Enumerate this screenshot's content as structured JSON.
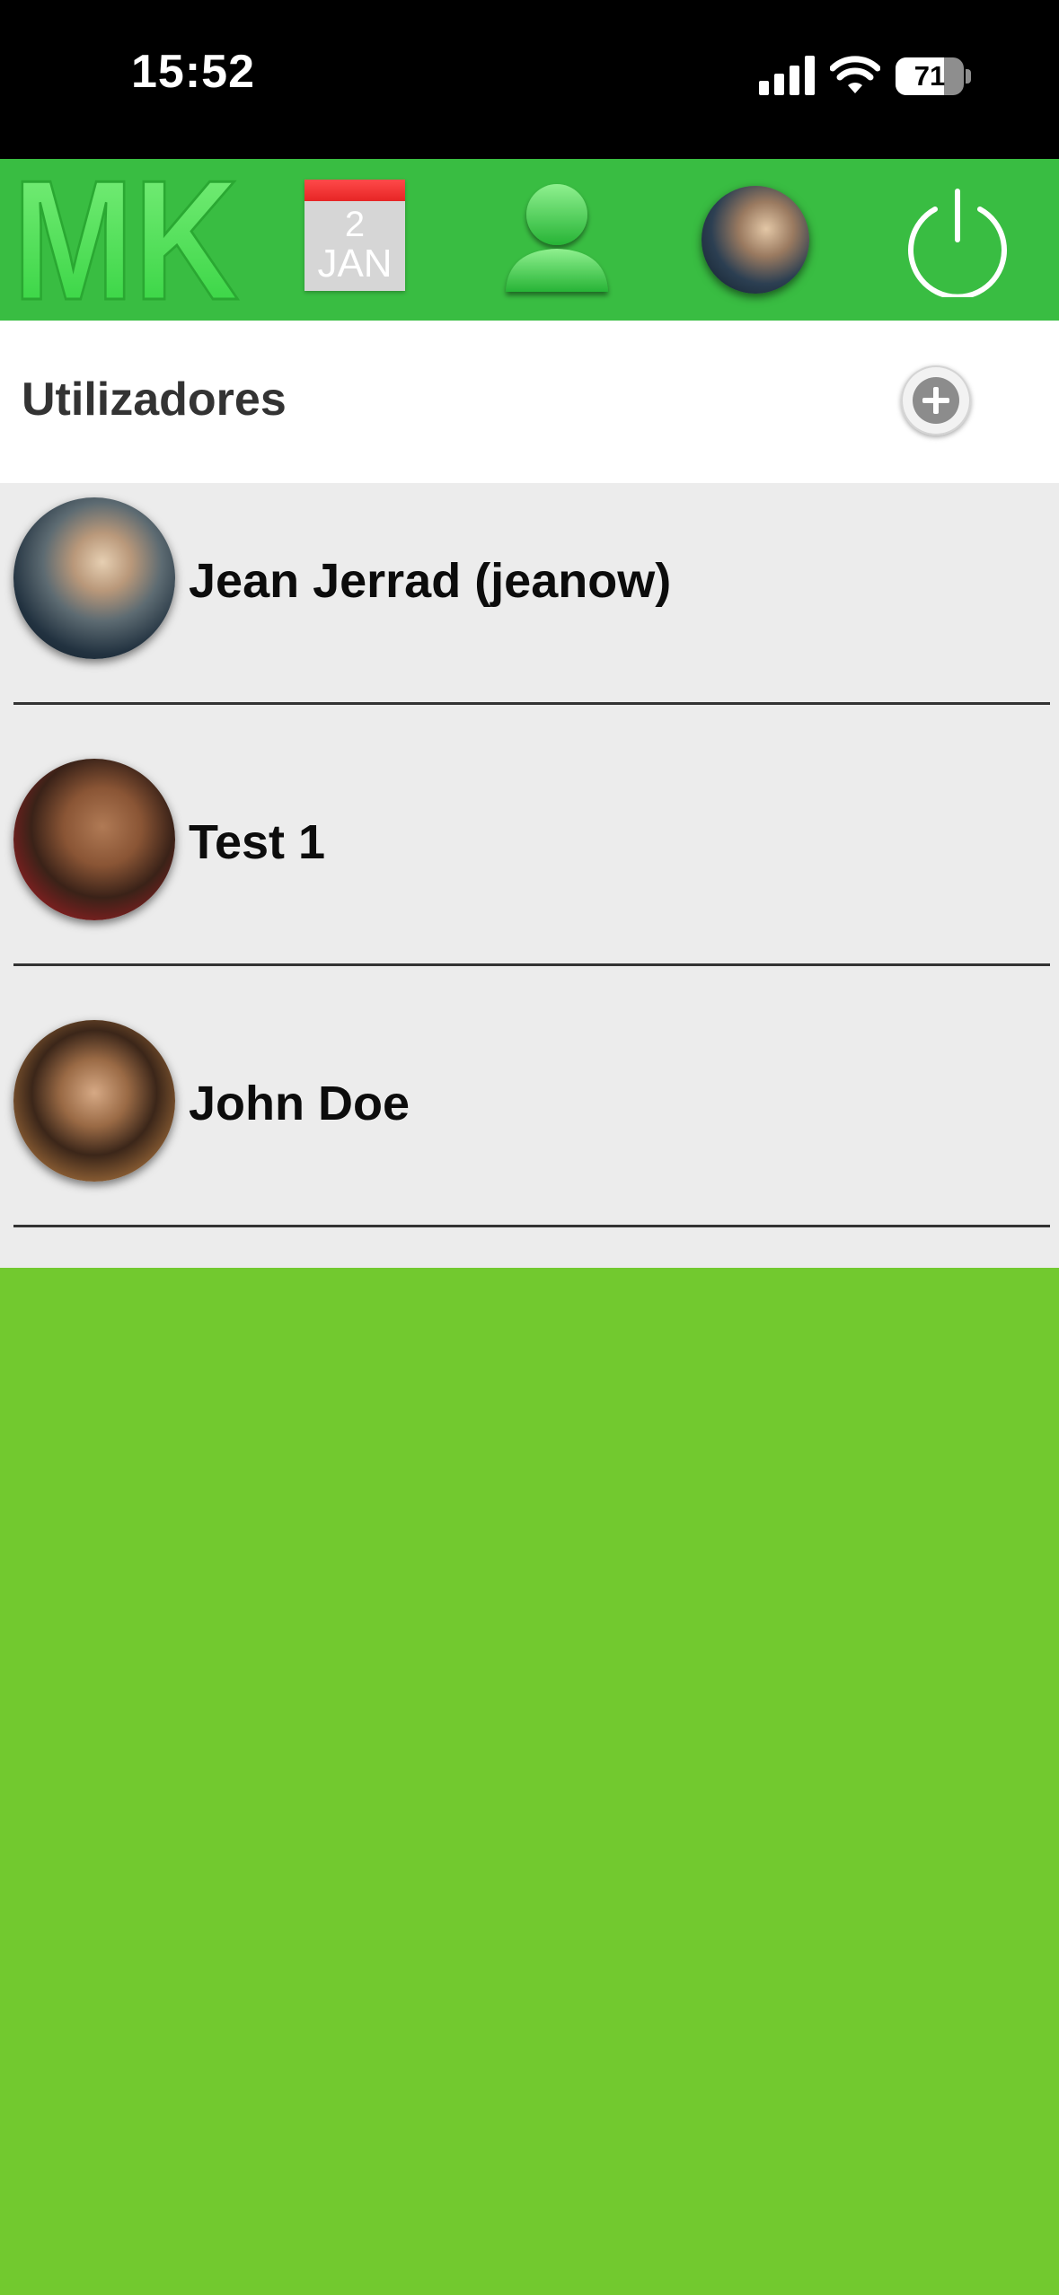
{
  "status_bar": {
    "time": "15:52",
    "battery_level": "71",
    "battery_fraction": 0.71,
    "icons": [
      "signal-icon",
      "wifi-icon",
      "battery-icon"
    ]
  },
  "header": {
    "logo_text": "MK",
    "calendar": {
      "day": "2",
      "month": "JAN"
    },
    "icons": [
      "mk-logo",
      "calendar-icon",
      "user-icon",
      "profile-avatar",
      "power-icon"
    ]
  },
  "section": {
    "title": "Utilizadores"
  },
  "users": [
    {
      "name": "Jean Jerrad (jeanow)"
    },
    {
      "name": "Test 1"
    },
    {
      "name": "John Doe"
    }
  ],
  "colors": {
    "header_green": "#39bd42",
    "background_green": "#72c92f",
    "list_background": "#ececec",
    "status_bar": "#000000"
  }
}
